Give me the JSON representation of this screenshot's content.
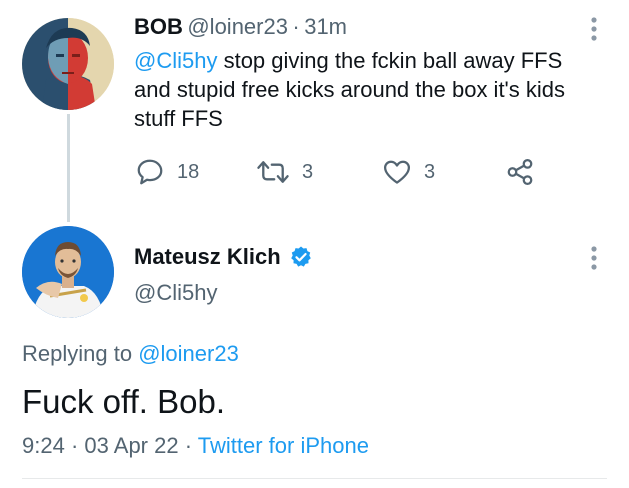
{
  "reply_to_tweet": {
    "author_name": "BOB",
    "author_handle": "@loiner23",
    "separator": "·",
    "time_ago": "31m",
    "mention": "@Cli5hy",
    "text_line1_rest": " stop giving the fckin ball away FFS",
    "text_line2": "and stupid free kicks around the box it's kids",
    "text_line3": "stuff FFS",
    "reply_count": "18",
    "retweet_count": "3",
    "like_count": "3",
    "icons": [
      "reply-icon",
      "retweet-icon",
      "like-icon",
      "share-icon",
      "more-icon"
    ]
  },
  "main_tweet": {
    "author_name": "Mateusz Klich",
    "author_handle": "@Cli5hy",
    "verified": true,
    "replying_prefix": "Replying to ",
    "replying_to": "@loiner23",
    "text": "Fuck off. Bob.",
    "time": "9:24",
    "sep1": "·",
    "date": "03 Apr 22",
    "sep2": "·",
    "client": "Twitter for iPhone"
  },
  "colors": {
    "accent": "#1d9bf0",
    "text": "#0f1419",
    "muted": "#536471",
    "divider": "#e7e9ea"
  }
}
